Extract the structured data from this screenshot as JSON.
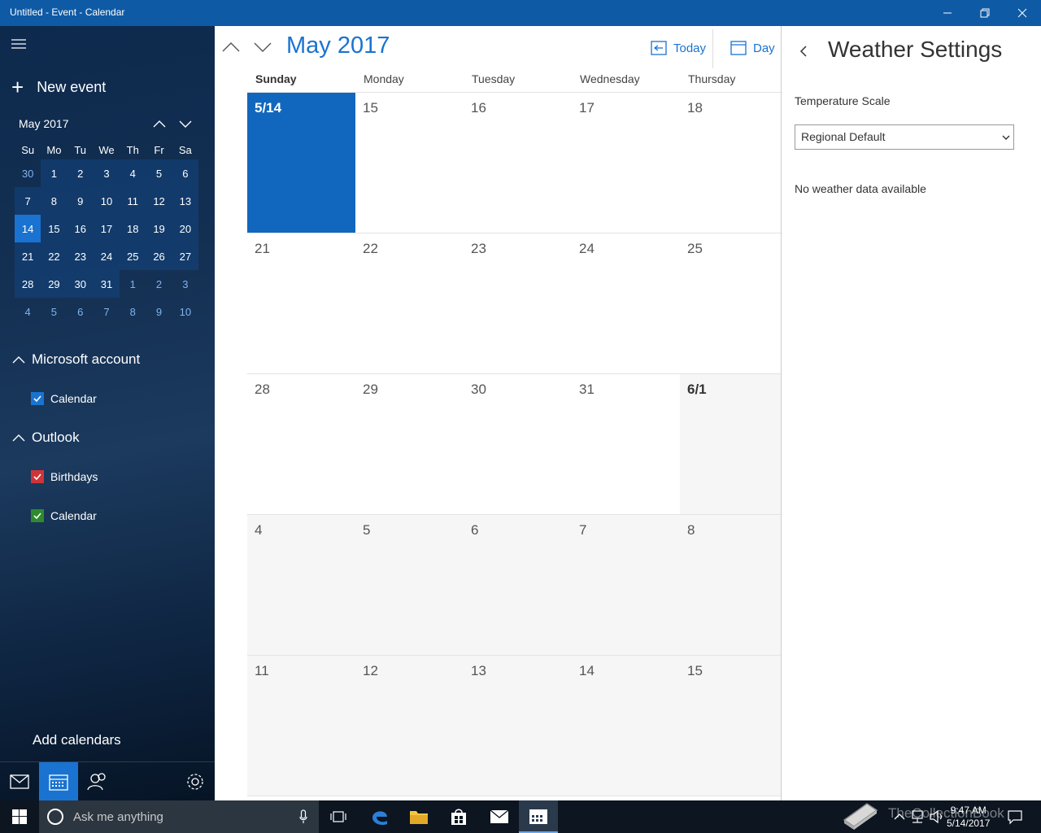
{
  "window": {
    "title": "Untitled - Event - Calendar"
  },
  "sidebar": {
    "new_event": "New event",
    "mini_calendar": {
      "month_label": "May 2017",
      "weekdays": [
        "Su",
        "Mo",
        "Tu",
        "We",
        "Th",
        "Fr",
        "Sa"
      ],
      "weeks": [
        [
          "30",
          "1",
          "2",
          "3",
          "4",
          "5",
          "6"
        ],
        [
          "7",
          "8",
          "9",
          "10",
          "11",
          "12",
          "13"
        ],
        [
          "14",
          "15",
          "16",
          "17",
          "18",
          "19",
          "20"
        ],
        [
          "21",
          "22",
          "23",
          "24",
          "25",
          "26",
          "27"
        ],
        [
          "28",
          "29",
          "30",
          "31",
          "1",
          "2",
          "3"
        ],
        [
          "4",
          "5",
          "6",
          "7",
          "8",
          "9",
          "10"
        ]
      ],
      "selected_day": "14"
    },
    "groups": [
      {
        "name": "Microsoft account",
        "calendars": [
          {
            "name": "Calendar",
            "color": "#1a73d0",
            "checked": true
          }
        ]
      },
      {
        "name": "Outlook",
        "calendars": [
          {
            "name": "Birthdays",
            "color": "#d13438",
            "checked": true
          },
          {
            "name": "Calendar",
            "color": "#2d8a2d",
            "checked": true
          }
        ]
      }
    ],
    "add_calendars": "Add calendars"
  },
  "main": {
    "month_title": "May 2017",
    "today_label": "Today",
    "view_label": "Day",
    "weekdays": [
      "Sunday",
      "Monday",
      "Tuesday",
      "Wednesday",
      "Thursday"
    ],
    "weeks": [
      [
        "5/14",
        "15",
        "16",
        "17",
        "18"
      ],
      [
        "21",
        "22",
        "23",
        "24",
        "25"
      ],
      [
        "28",
        "29",
        "30",
        "31",
        "6/1"
      ],
      [
        "4",
        "5",
        "6",
        "7",
        "8"
      ],
      [
        "11",
        "12",
        "13",
        "14",
        "15"
      ]
    ]
  },
  "weather": {
    "title": "Weather Settings",
    "temperature_label": "Temperature Scale",
    "temperature_value": "Regional Default",
    "no_data": "No weather data available"
  },
  "taskbar": {
    "search_placeholder": "Ask me anything",
    "time": "9:47 AM",
    "date": "5/14/2017",
    "watermark": "TheCollectionBook"
  },
  "colors": {
    "accent": "#1a73d0",
    "titlebar": "#0f5aa5",
    "today_cell": "#1167bd"
  }
}
